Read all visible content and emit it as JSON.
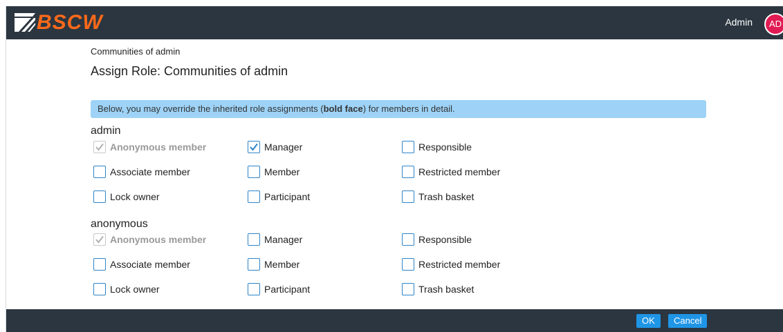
{
  "header": {
    "logo_text": "BSCW",
    "user_name": "Admin",
    "avatar_initials": "AD"
  },
  "breadcrumb": "Communities of admin",
  "page_title": "Assign Role: Communities of admin",
  "info": {
    "before": "Below, you may override the inherited role assignments (",
    "bold": "bold face",
    "after": ") for members in detail."
  },
  "sections": [
    {
      "name": "admin",
      "roles": [
        {
          "label": "Anonymous member",
          "checked": true,
          "inherited": true
        },
        {
          "label": "Manager",
          "checked": true,
          "inherited": false
        },
        {
          "label": "Responsible",
          "checked": false,
          "inherited": false
        },
        {
          "label": "Associate member",
          "checked": false,
          "inherited": false
        },
        {
          "label": "Member",
          "checked": false,
          "inherited": false
        },
        {
          "label": "Restricted member",
          "checked": false,
          "inherited": false
        },
        {
          "label": "Lock owner",
          "checked": false,
          "inherited": false
        },
        {
          "label": "Participant",
          "checked": false,
          "inherited": false
        },
        {
          "label": "Trash basket",
          "checked": false,
          "inherited": false
        }
      ]
    },
    {
      "name": "anonymous",
      "roles": [
        {
          "label": "Anonymous member",
          "checked": true,
          "inherited": true
        },
        {
          "label": "Manager",
          "checked": false,
          "inherited": false
        },
        {
          "label": "Responsible",
          "checked": false,
          "inherited": false
        },
        {
          "label": "Associate member",
          "checked": false,
          "inherited": false
        },
        {
          "label": "Member",
          "checked": false,
          "inherited": false
        },
        {
          "label": "Restricted member",
          "checked": false,
          "inherited": false
        },
        {
          "label": "Lock owner",
          "checked": false,
          "inherited": false
        },
        {
          "label": "Participant",
          "checked": false,
          "inherited": false
        },
        {
          "label": "Trash basket",
          "checked": false,
          "inherited": false
        }
      ]
    }
  ],
  "buttons": {
    "ok": "OK",
    "cancel": "Cancel"
  },
  "colors": {
    "header_bg": "#2b3640",
    "logo": "#ff6a1a",
    "avatar": "#e11b53",
    "info_banner": "#9ed3f7",
    "checkbox_border": "#2d84c8",
    "button": "#1f95e6"
  }
}
